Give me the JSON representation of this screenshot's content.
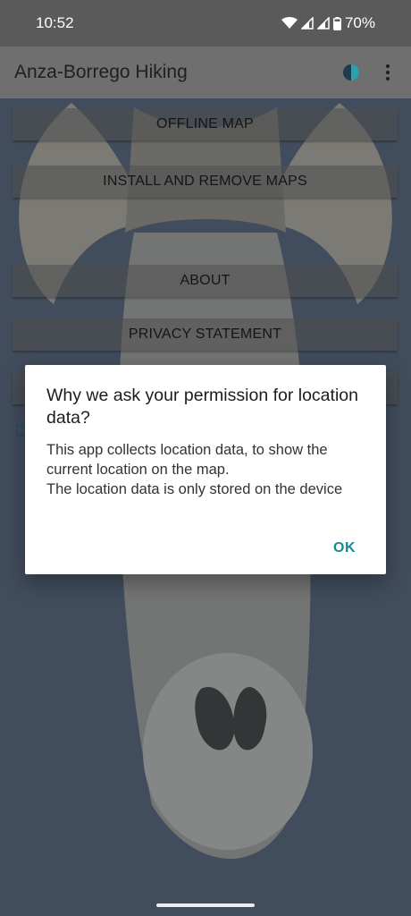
{
  "status_bar": {
    "time": "10:52",
    "battery": "70%",
    "icons": [
      "wifi-icon",
      "signal-icon",
      "signal-icon",
      "battery-icon"
    ]
  },
  "app_bar": {
    "title": "Anza-Borrego Hiking",
    "icons": [
      "theme-toggle-icon",
      "more-vert-icon"
    ]
  },
  "menu": {
    "items": [
      {
        "label": "OFFLINE MAP"
      },
      {
        "label": "INSTALL AND REMOVE MAPS"
      },
      {
        "label": "ABOUT"
      },
      {
        "label": "PRIVACY STATEMENT"
      }
    ]
  },
  "dialog": {
    "title": "Why we ask your permission for location data?",
    "message": "This app collects location data, to show the current location on the map.\n The location data is only stored on the device",
    "ok_label": "OK"
  },
  "colors": {
    "accent": "#168a8f",
    "app_bar": "#6f6f6f",
    "background": "#4e5c6e"
  }
}
